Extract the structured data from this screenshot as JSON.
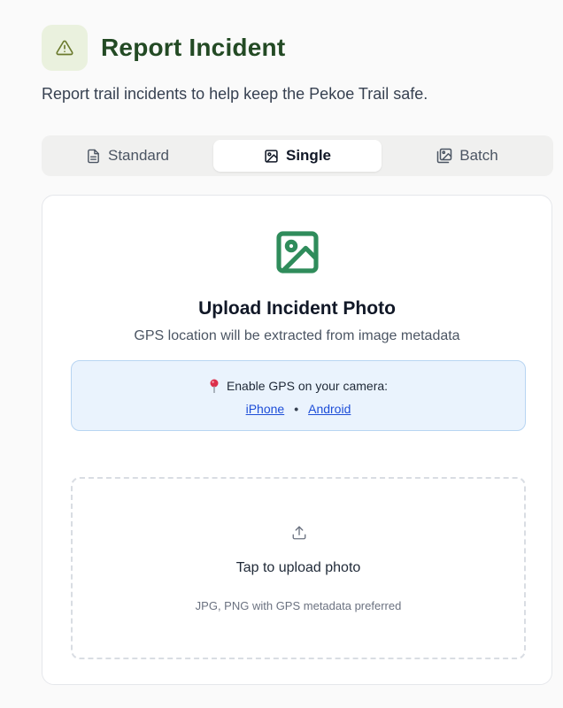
{
  "header": {
    "icon": "warning-triangle-icon",
    "title": "Report Incident",
    "subtitle": "Report trail incidents to help keep the Pekoe Trail safe."
  },
  "tabs": [
    {
      "label": "Standard",
      "icon": "document-icon",
      "active": false
    },
    {
      "label": "Single",
      "icon": "image-icon",
      "active": true
    },
    {
      "label": "Batch",
      "icon": "images-icon",
      "active": false
    }
  ],
  "upload_card": {
    "icon": "image-icon",
    "title": "Upload Incident Photo",
    "subtitle": "GPS location will be extracted from image metadata",
    "gps_notice": {
      "icon": "map-pin-icon",
      "text": "Enable GPS on your camera:",
      "links": [
        "iPhone",
        "Android"
      ],
      "separator": "•"
    },
    "dropzone": {
      "icon": "upload-icon",
      "title": "Tap to upload photo",
      "hint": "JPG, PNG with GPS metadata preferred"
    }
  },
  "colors": {
    "title": "#234a24",
    "accent": "#2f8c5b",
    "header_icon_bg": "#eaf1de",
    "notice_bg": "#eaf3fd",
    "notice_border": "#b8d5f2",
    "link": "#1d4ed8",
    "pin": "#dc2f4a"
  }
}
